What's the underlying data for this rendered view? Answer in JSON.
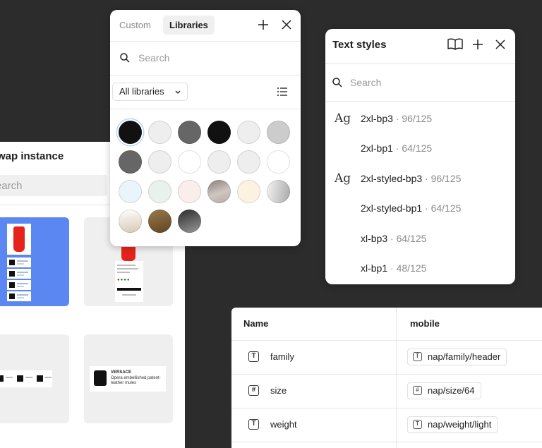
{
  "swap_panel": {
    "title": "Swap instance",
    "search_placeholder": "Search",
    "thumbnails": [
      {
        "name": "dress-list"
      },
      {
        "name": "product-card"
      },
      {
        "name": "tshirt-strip"
      },
      {
        "name": "versace-card",
        "brand": "VERSACE",
        "desc": "Opera embellished patent-leather mules"
      }
    ]
  },
  "libraries_panel": {
    "tabs": [
      {
        "label": "Custom",
        "active": false
      },
      {
        "label": "Libraries",
        "active": true
      }
    ],
    "search_placeholder": "Search",
    "filter_label": "All libraries",
    "swatches": [
      "#111111",
      "#eeeeee",
      "#666666",
      "#111111",
      "#eeeeee",
      "#cccccc",
      "#666666",
      "#eeeeee",
      "#ffffff",
      "#eeeeee",
      "#eeeeee",
      "#ffffff",
      "#e9f4fb",
      "#e8f2ec",
      "#f9eeec",
      "gradient-taupe",
      "#fbf2e1",
      "gradient-silver",
      "gradient-sand",
      "gradient-bronze",
      "gradient-gunmetal"
    ],
    "colors": {
      "selected_ring": "#bcd3f5"
    }
  },
  "text_styles_panel": {
    "title": "Text styles",
    "search_placeholder": "Search",
    "preview_glyph": "Ag",
    "items": [
      {
        "name": "2xl-bp3",
        "meta": " · 96/125",
        "show_preview": true
      },
      {
        "name": "2xl-bp1",
        "meta": " · 64/125",
        "show_preview": false
      },
      {
        "name": "2xl-styled-bp3",
        "meta": " · 96/125",
        "show_preview": true
      },
      {
        "name": "2xl-styled-bp1",
        "meta": " · 64/125",
        "show_preview": false
      },
      {
        "name": "xl-bp3",
        "meta": " · 64/125",
        "show_preview": false
      },
      {
        "name": "xl-bp1",
        "meta": " · 48/125",
        "show_preview": false
      }
    ]
  },
  "variables_table": {
    "headers": {
      "name": "Name",
      "mode": "mobile"
    },
    "rows": [
      {
        "type_glyph": "T",
        "name": "family",
        "value": "nap/family/header"
      },
      {
        "type_glyph": "#",
        "name": "size",
        "value": "nap/size/64"
      },
      {
        "type_glyph": "T",
        "name": "weight",
        "value": "nap/weight/light"
      }
    ]
  },
  "colors": {
    "canvas": "#2c2c2c",
    "accent": "#5b87f2",
    "panel": "#ffffff"
  }
}
